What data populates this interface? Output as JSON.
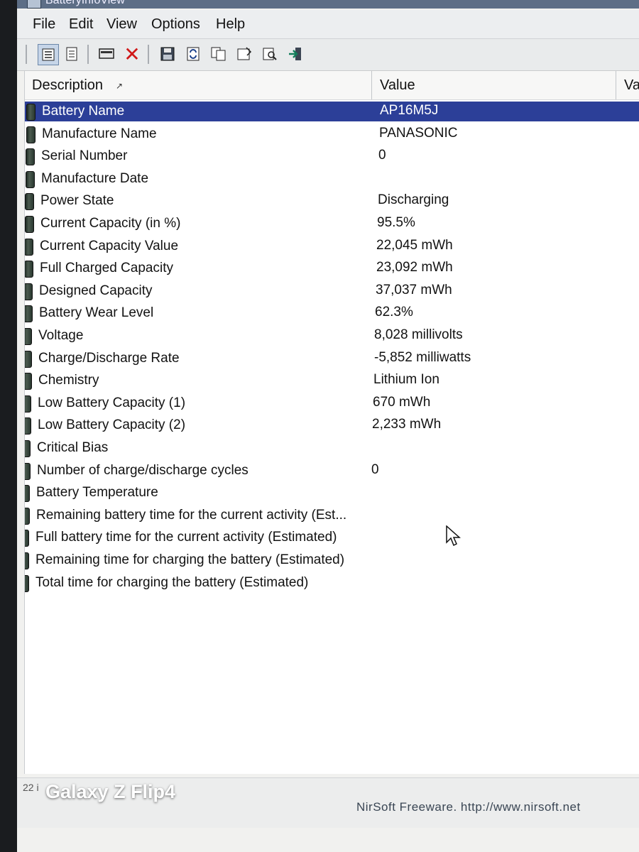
{
  "window": {
    "title": "BatteryInfoView"
  },
  "menu": [
    "File",
    "Edit",
    "View",
    "Options",
    "Help"
  ],
  "toolbar": {
    "buttons": [
      "details-view-icon",
      "list-view-icon",
      "monitor-icon",
      "delete-icon",
      "save-icon",
      "refresh-icon",
      "copy-icon",
      "properties-icon",
      "find-icon",
      "exit-icon"
    ]
  },
  "columns": {
    "description": "Description",
    "value": "Value",
    "third": "Va"
  },
  "rows": [
    {
      "label": "Battery Name",
      "value": "AP16M5J",
      "selected": true
    },
    {
      "label": "Manufacture Name",
      "value": "PANASONIC"
    },
    {
      "label": "Serial Number",
      "value": "0"
    },
    {
      "label": "Manufacture Date",
      "value": ""
    },
    {
      "label": "Power State",
      "value": "Discharging"
    },
    {
      "label": "Current Capacity (in %)",
      "value": "95.5%"
    },
    {
      "label": "Current Capacity Value",
      "value": "22,045 mWh"
    },
    {
      "label": "Full Charged Capacity",
      "value": "23,092 mWh"
    },
    {
      "label": "Designed Capacity",
      "value": "37,037 mWh"
    },
    {
      "label": "Battery Wear Level",
      "value": "62.3%"
    },
    {
      "label": "Voltage",
      "value": "8,028 millivolts"
    },
    {
      "label": "Charge/Discharge Rate",
      "value": "-5,852 milliwatts"
    },
    {
      "label": "Chemistry",
      "value": "Lithium Ion"
    },
    {
      "label": "Low Battery Capacity (1)",
      "value": "670 mWh"
    },
    {
      "label": "Low Battery Capacity (2)",
      "value": "2,233 mWh"
    },
    {
      "label": "Critical Bias",
      "value": ""
    },
    {
      "label": "Number of charge/discharge cycles",
      "value": "0"
    },
    {
      "label": "Battery Temperature",
      "value": ""
    },
    {
      "label": "Remaining battery time for the current activity (Est...",
      "value": ""
    },
    {
      "label": "Full battery time for the current activity (Estimated)",
      "value": ""
    },
    {
      "label": "Remaining time for charging the battery (Estimated)",
      "value": ""
    },
    {
      "label": "Total  time for charging the battery (Estimated)",
      "value": ""
    }
  ],
  "status": {
    "count": "22 i",
    "credit": "NirSoft Freeware.  http://www.nirsoft.net"
  },
  "overlay": {
    "watermark": "Galaxy Z Flip4"
  },
  "colors": {
    "selection": "#2c3f98",
    "window_bg": "#f1f1ef",
    "list_bg": "#ffffff"
  }
}
